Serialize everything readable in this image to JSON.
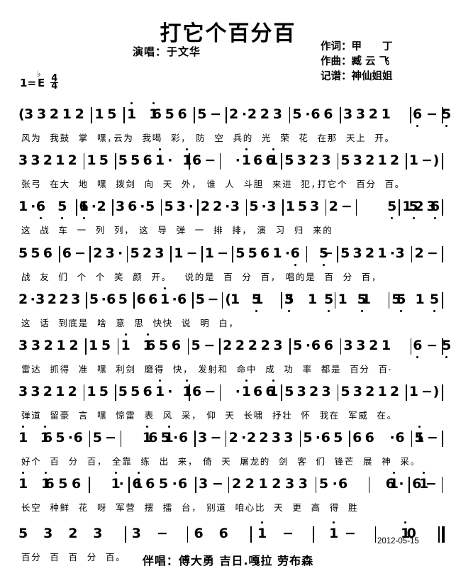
{
  "header": {
    "title": "打它个百分百",
    "singer": "演唱：于文华",
    "lyricist": "作词：甲　　丁",
    "composer": "作曲：臧 云 飞",
    "transcriber": "记谱：神仙姐姐"
  },
  "key_signature": {
    "do_label": "1",
    "equals": "=",
    "key": "E",
    "accidental": "♭",
    "meter_top": "4",
    "meter_bottom": "4"
  },
  "footer": {
    "date": "2012-05-15",
    "chorus_credit": "伴唱：傅大勇 吉日.嘎拉 劳布森"
  },
  "score": {
    "systems": [
      {
        "id": "line-1",
        "notes": "( 3 3 2  1 2 | 1  5 | 1̇ 1̇ 6  5 6 | 5  −  | 2 · 2  2 3 | 5 · 6  6 | 3 3 2  1 6̣ | 5̣  −  |",
        "lyrics": "风为　我鼓　掌　嘿，云为　我喝　彩，　防　空　兵的　光　荣　花　在那　天上　开。"
      },
      {
        "id": "line-2",
        "notes": "3 3 2  1 2 | 1  5 | 5 5 6  1̇ · 1̇ | 6  −  | 1̇ · 1̇  6 6 | 5 3 2  3 | 5 3 2  1 2 | 1  − ) |",
        "lyrics": "张弓　在大　地　嘿　拨剑　向　天　外，　谁　人　斗胆　来进　犯，打它个　百分　百。"
      },
      {
        "id": "line-3",
        "notes": "1 · 6̣  5̣ 6̣ | 1 · 2 | 3  6 · 5 | 5  3 · | 2  2 · 3 | 5 · 3 | 1  5 3 | 2  −  | 5̣  5̣  6̣ | 1  2 3 |",
        "lyrics": "这　战　车　一　列　列，　这　导　弹　一　排　排，　演　习　归　来的"
      },
      {
        "id": "line-4",
        "notes": "5  5 6 | 6  −  | 2  3 · | 5  2 3 | 1  −  | 1  −  | 5 5 6  1 · 6̣ | 5̣  −  | 5 3 2  1 · 3 | 2  −  |",
        "lyrics": "战　友　们　个　个　笑　颜　开。　　说的是　百　分　百，　唱的是　百　分　百，"
      },
      {
        "id": "line-5",
        "notes": "2 · 3  2 2 3 | 5 · 6  5 | 6 6  1̇ · 6 | 5  −  | ( 1 5̣  1 5̣ | 3 5̣  1 5̣ | 1 5̣  1 5̣ | 5 5̣  1 5̣ |",
        "lyrics": "这　话　到底是　啥　意　思　快快　说　明　白，"
      },
      {
        "id": "line-6",
        "notes": "3 3 2  1 2 | 1  5 | 1̇ 1̇ 6  5 6 | 5  −  | 2 2 2  2 3 | 5 · 6  6 | 3 3 2  1 6̣ | 5̣  −  |",
        "lyrics": "雷达　抓得　准　嘿　利剑　磨得　快，　发射和　命中　成　功　率　都是　百分　百."
      },
      {
        "id": "line-7",
        "notes": "3 3 2  1 2 | 1  5 | 5 5 6  1̇ · 1̇ | 6  −  | 1̇ · 1̇  6 6 | 5 3 2  3 | 5 3 2  1 2 | 1  − ) |",
        "lyrics": "弹道　留豪　言　嘿　惊雷　表　风　采，　仰　天　长啸　抒壮　怀　我在　军威　在。"
      },
      {
        "id": "line-8",
        "notes": "1̇ 1̇ 6  5 · 6 | 5  −  | 1̇ 1̇ 6  5 · 6 | 3  −  | 2 · 2  2 3 3 | 5 · 6  5 | 6 6  1̇ · 6 | 5  −  |",
        "lyrics": "好个　百　分　百，　全靠　练　出　来，　倚　天　屠龙的　剑　客　们　锋芒　展　神　采。"
      },
      {
        "id": "line-9",
        "notes": "1̇ 1̇ 6  5 6 | 1̇  1̇ · | 6 6  5 · 6 | 3  −  | 2 2 1  2 3 3 | 5 · 6  1̇ | 1̇  6 · | 6  −  |",
        "lyrics": "长空　种鲜　花　呀　军营　摆　擂　台，　别道　咱心比　天　更　高　得　胜"
      },
      {
        "id": "line-10",
        "notes": "5 3 2  3 | 3  −  | 6  6 | 1̇  −  | 1̇  −  | 1̇  0 ‖",
        "lyrics": "百分　百　百　分　百。"
      }
    ]
  }
}
